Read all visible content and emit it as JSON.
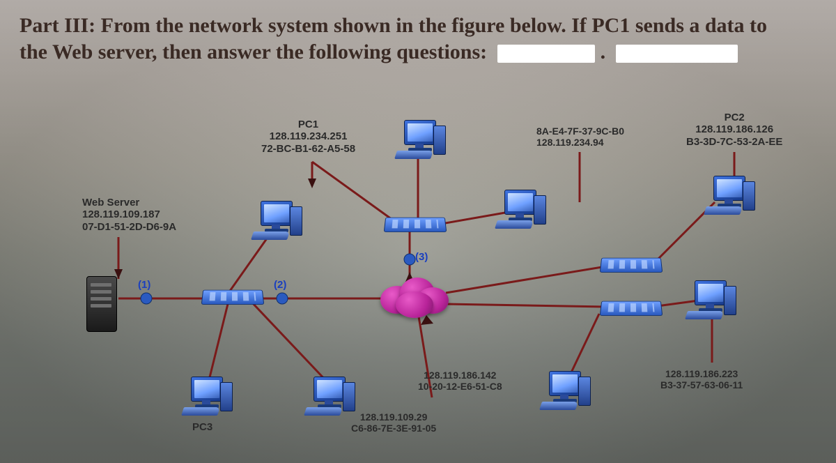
{
  "prompt_line1": "Part III: From the network system shown in the figure below. If PC1 sends a data to",
  "prompt_line2": "the Web server, then answer the following questions:",
  "devices": {
    "pc1": {
      "name": "PC1",
      "ip": "128.119.234.251",
      "mac": "72-BC-B1-62-A5-58"
    },
    "pc2": {
      "name": "PC2",
      "ip": "128.119.186.126",
      "mac": "B3-3D-7C-53-2A-EE"
    },
    "pc3": {
      "name": "PC3"
    },
    "web": {
      "name": "Web Server",
      "ip": "128.119.109.187",
      "mac": "07-D1-51-2D-D6-9A"
    },
    "r_if_a": {
      "ip": "128.119.234.94",
      "mac": "8A-E4-7F-37-9C-B0"
    },
    "r_if_b": {
      "ip": "128.119.186.142",
      "mac": "10-20-12-E6-51-C8"
    },
    "r_if_c": {
      "ip": "128.119.109.29",
      "mac": "C6-86-7E-3E-91-05"
    },
    "host_d": {
      "ip": "128.119.186.223",
      "mac": "B3-37-57-63-06-11"
    }
  },
  "link_labels": {
    "l1": "(1)",
    "l2": "(2)",
    "l3": "(3)"
  }
}
